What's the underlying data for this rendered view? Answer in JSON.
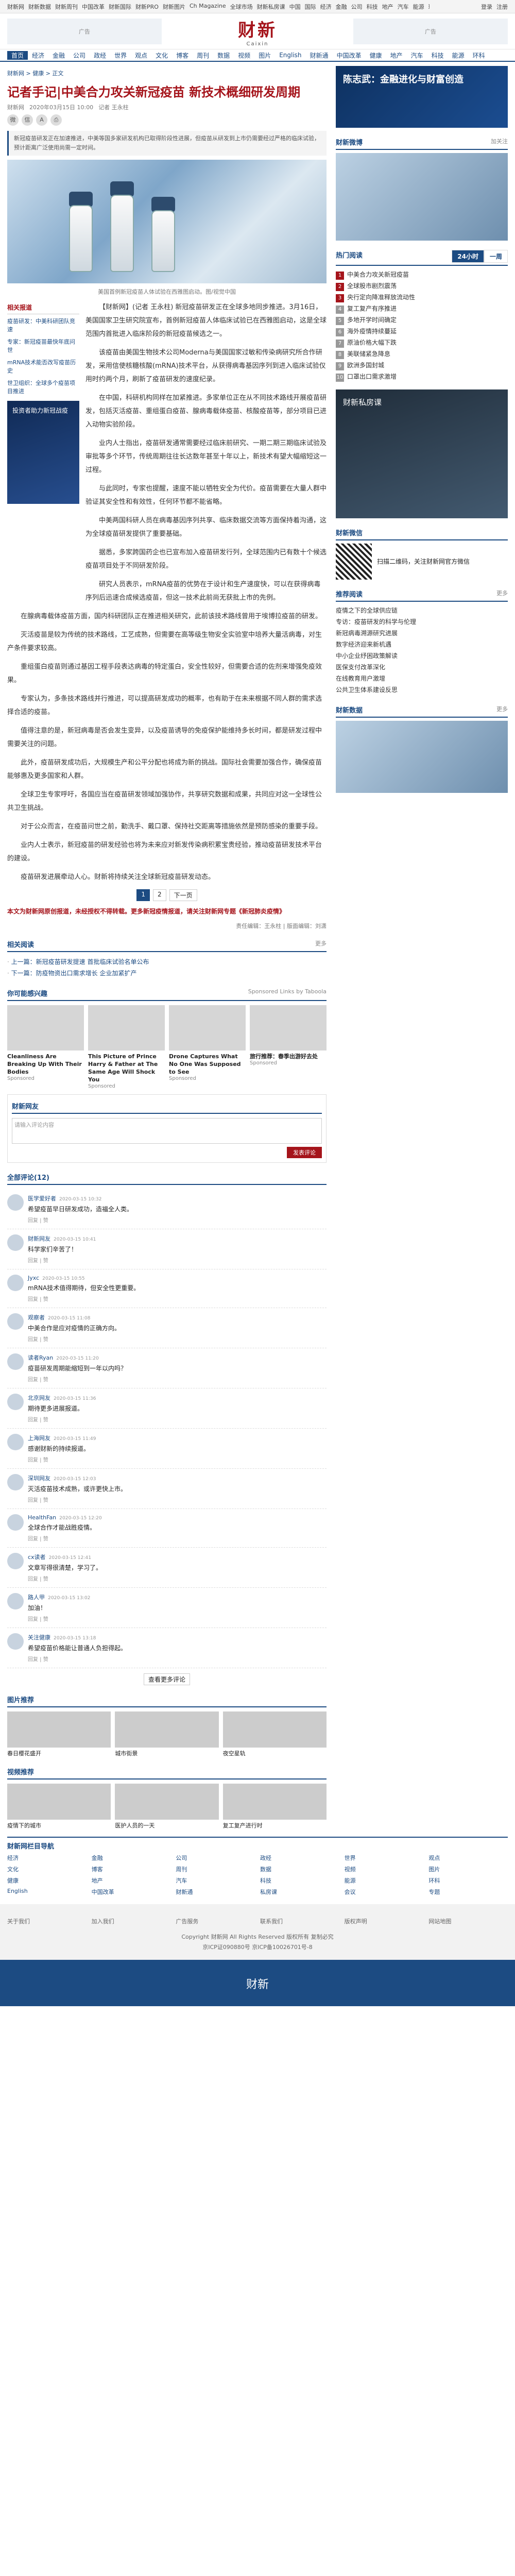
{
  "topbar": {
    "links": [
      "财新网",
      "财新数据",
      "财新周刊",
      "中国改革",
      "财新国际",
      "财新PRO",
      "财新图片",
      "Ch Magazine",
      "全球市场",
      "财新私房课",
      "中国",
      "国际",
      "经济",
      "金融",
      "公司",
      "科技",
      "地产",
      "汽车",
      "能源",
      "环科",
      "健康",
      "文化",
      "图片",
      "视听",
      "数据",
      "博客"
    ],
    "login": "登录",
    "register": "注册"
  },
  "masthead": {
    "ad_text": "广告",
    "logo_cn": "财新",
    "logo_en": "Caixin"
  },
  "nav": {
    "items": [
      "首页",
      "经济",
      "金融",
      "公司",
      "政经",
      "世界",
      "观点",
      "文化",
      "博客",
      "周刊",
      "数据",
      "视频",
      "图片",
      "English",
      "财新通",
      "中国改革",
      "健康",
      "地产",
      "汽车",
      "科技",
      "能源",
      "环科"
    ],
    "active": 0
  },
  "breadcrumb": {
    "path": "财新网 > 健康 > 正文"
  },
  "article": {
    "title": "记者手记|中美合力攻关新冠疫苗 新技术概细研发周期",
    "source": "财新网",
    "date": "2020年03月15日 10:00",
    "author": "记者 王永柱",
    "summary": "新冠疫苗研发正在加速推进，中美等国多家研发机构已取得阶段性进展，但疫苗从研发到上市仍需要经过严格的临床试验，预计距离广泛使用尚需一定时间。",
    "hero_caption": "美国首例新冠疫苗人体试验在西雅图启动。图/视觉中国",
    "related_label": "相关报道",
    "related": [
      "疫苗研发：中美科研团队竞速",
      "专家：新冠疫苗最快年底问世",
      "mRNA技术能否改写疫苗历史",
      "世卫组织：全球多个疫苗项目推进"
    ],
    "side_ad": "投资者助力新冠战疫",
    "paragraphs": [
      "【财新网】(记者 王永柱) 新冠疫苗研发正在全球多地同步推进。3月16日，美国国家卫生研究院宣布，首例新冠疫苗人体临床试验已在西雅图启动，这是全球范围内首批进入临床阶段的新冠疫苗候选之一。",
      "该疫苗由美国生物技术公司Moderna与美国国家过敏和传染病研究所合作研发，采用信使核糖核酸(mRNA)技术平台，从获得病毒基因序列到进入临床试验仅用时约两个月，刷新了疫苗研发的速度纪录。",
      "在中国，科研机构同样在加紧推进。多家单位正在从不同技术路线开展疫苗研发，包括灭活疫苗、重组蛋白疫苗、腺病毒载体疫苗、核酸疫苗等，部分项目已进入动物实验阶段。",
      "业内人士指出，疫苗研发通常需要经过临床前研究、一期二期三期临床试验及审批等多个环节，传统周期往往长达数年甚至十年以上，新技术有望大幅缩短这一过程。",
      "与此同时，专家也提醒，速度不能以牺牲安全为代价。疫苗需要在大量人群中验证其安全性和有效性，任何环节都不能省略。",
      "中美两国科研人员在病毒基因序列共享、临床数据交流等方面保持着沟通，这为全球疫苗研发提供了重要基础。",
      "据悉，多家跨国药企也已宣布加入疫苗研发行列，全球范围内已有数十个候选疫苗项目处于不同研发阶段。",
      "研究人员表示，mRNA疫苗的优势在于设计和生产速度快，可以在获得病毒序列后迅速合成候选疫苗，但这一技术此前尚无获批上市的先例。",
      "在腺病毒载体疫苗方面，国内科研团队正在推进相关研究，此前该技术路线曾用于埃博拉疫苗的研发。",
      "灭活疫苗是较为传统的技术路线，工艺成熟，但需要在高等级生物安全实验室中培养大量活病毒，对生产条件要求较高。",
      "重组蛋白疫苗则通过基因工程手段表达病毒的特定蛋白，安全性较好，但需要合适的佐剂来增强免疫效果。",
      "专家认为，多条技术路线并行推进，可以提高研发成功的概率，也有助于在未来根据不同人群的需求选择合适的疫苗。",
      "值得注意的是，新冠病毒是否会发生变异，以及疫苗诱导的免疫保护能维持多长时间，都是研发过程中需要关注的问题。",
      "此外，疫苗研发成功后，大规模生产和公平分配也将成为新的挑战。国际社会需要加强合作，确保疫苗能够惠及更多国家和人群。",
      "全球卫生专家呼吁，各国应当在疫苗研发领域加强协作，共享研究数据和成果，共同应对这一全球性公共卫生挑战。",
      "对于公众而言，在疫苗问世之前，勤洗手、戴口罩、保持社交距离等措施依然是预防感染的重要手段。",
      "业内人士表示，新冠疫苗的研发经验也将为未来应对新发传染病积累宝贵经验，推动疫苗研发技术平台的建设。",
      "疫苗研发进展牵动人心。财新将持续关注全球新冠疫苗研发动态。"
    ],
    "pages": [
      "1",
      "2",
      "下一页"
    ],
    "notice": "本文为财新网原创报道，未经授权不得转载。更多新冠疫情报道，请关注财新网专题《新冠肺炎疫情》",
    "editor": "责任编辑：王永柱 | 版面编辑：刘潇"
  },
  "related_section": {
    "label": "相关阅读",
    "more": "更多",
    "items": [
      "上一篇：新冠疫苗研发提速 首批临床试验名单公布",
      "下一篇：防疫物资出口需求增长 企业加紧扩产"
    ]
  },
  "promo": {
    "label": "你可能感兴趣",
    "sub": "Sponsored Links by Taboola",
    "cards": [
      {
        "t": "Cleanliness Are Breaking Up With Their Bodies",
        "s": "Sponsored"
      },
      {
        "t": "This Picture of Prince Harry & Father at The Same Age Will Shock You",
        "s": "Sponsored"
      },
      {
        "t": "Drone Captures What No One Was Supposed to See",
        "s": "Sponsored"
      },
      {
        "t": "旅行推荐：春季出游好去处",
        "s": "Sponsored"
      }
    ]
  },
  "comments_box": {
    "label": "财新网友",
    "placeholder": "请输入评论内容",
    "submit": "发表评论"
  },
  "comments_header": {
    "label": "全部评论",
    "count": "(12)"
  },
  "comments": [
    {
      "user": "医学爱好者",
      "time": "2020-03-15 10:32",
      "text": "希望疫苗早日研发成功，造福全人类。",
      "act": "回复 | 赞"
    },
    {
      "user": "财新网友",
      "time": "2020-03-15 10:41",
      "text": "科学家们辛苦了！",
      "act": "回复 | 赞"
    },
    {
      "user": "Jyxc",
      "time": "2020-03-15 10:55",
      "text": "mRNA技术值得期待，但安全性更重要。",
      "act": "回复 | 赞"
    },
    {
      "user": "观察者",
      "time": "2020-03-15 11:08",
      "text": "中美合作是应对疫情的正确方向。",
      "act": "回复 | 赞"
    },
    {
      "user": "读者Ryan",
      "time": "2020-03-15 11:20",
      "text": "疫苗研发周期能缩短到一年以内吗？",
      "act": "回复 | 赞"
    },
    {
      "user": "北京网友",
      "time": "2020-03-15 11:36",
      "text": "期待更多进展报道。",
      "act": "回复 | 赞"
    },
    {
      "user": "上海网友",
      "time": "2020-03-15 11:49",
      "text": "感谢财新的持续报道。",
      "act": "回复 | 赞"
    },
    {
      "user": "深圳网友",
      "time": "2020-03-15 12:03",
      "text": "灭活疫苗技术成熟，或许更快上市。",
      "act": "回复 | 赞"
    },
    {
      "user": "HealthFan",
      "time": "2020-03-15 12:20",
      "text": "全球合作才能战胜疫情。",
      "act": "回复 | 赞"
    },
    {
      "user": "cx读者",
      "time": "2020-03-15 12:41",
      "text": "文章写得很清楚，学习了。",
      "act": "回复 | 赞"
    },
    {
      "user": "路人甲",
      "time": "2020-03-15 13:02",
      "text": "加油！",
      "act": "回复 | 赞"
    },
    {
      "user": "关注健康",
      "time": "2020-03-15 13:18",
      "text": "希望疫苗价格能让普通人负担得起。",
      "act": "回复 | 赞"
    }
  ],
  "more_comments": "查看更多评论",
  "image_section": {
    "label": "图片推荐",
    "items": [
      "春日樱花盛开",
      "城市街景",
      "夜空星轨"
    ]
  },
  "video_section": {
    "label": "视频推荐",
    "items": [
      "疫情下的城市",
      "医护人员的一天",
      "复工复产进行时"
    ]
  },
  "sidebar": {
    "ad1": "陈志武：金融进化与财富创造",
    "weibo_label": "财新微博",
    "weibo_follow": "加关注",
    "hot_label": "热门阅读",
    "hot_tabs": [
      "24小时",
      "一周"
    ],
    "hot": [
      "中美合力攻关新冠疫苗",
      "全球股市剧烈震荡",
      "央行定向降准释放流动性",
      "复工复产有序推进",
      "多地开学时间确定",
      "海外疫情持续蔓延",
      "原油价格大幅下跌",
      "美联储紧急降息",
      "欧洲多国封城",
      "口罩出口需求激增"
    ],
    "ad2": "财新私房课",
    "wechat_label": "财新微信",
    "wechat_text": "扫描二维码，关注财新网官方微信",
    "rec_label": "推荐阅读",
    "rec": [
      "疫情之下的全球供应链",
      "专访：疫苗研发的科学与伦理",
      "新冠病毒溯源研究进展",
      "数字经济迎来新机遇",
      "中小企业纾困政策解读",
      "医保支付改革深化",
      "在线教育用户激增",
      "公共卫生体系建设反思"
    ],
    "data_label": "财新数据",
    "more": "更多"
  },
  "footer": {
    "nav_label": "财新网栏目导航",
    "nav": [
      "经济",
      "金融",
      "公司",
      "政经",
      "世界",
      "观点",
      "文化",
      "博客",
      "周刊",
      "数据",
      "视频",
      "图片",
      "健康",
      "地产",
      "汽车",
      "科技",
      "能源",
      "环科",
      "English",
      "中国改革",
      "财新通",
      "私房课",
      "会议",
      "专题"
    ],
    "about": [
      "关于我们",
      "加入我们",
      "广告服务",
      "联系我们",
      "版权声明",
      "网站地图"
    ],
    "copyright": "Copyright 财新网 All Rights Reserved 版权所有 复制必究",
    "icp": "京ICP证090880号 京ICP备10026701号-8",
    "logo": "财新"
  }
}
